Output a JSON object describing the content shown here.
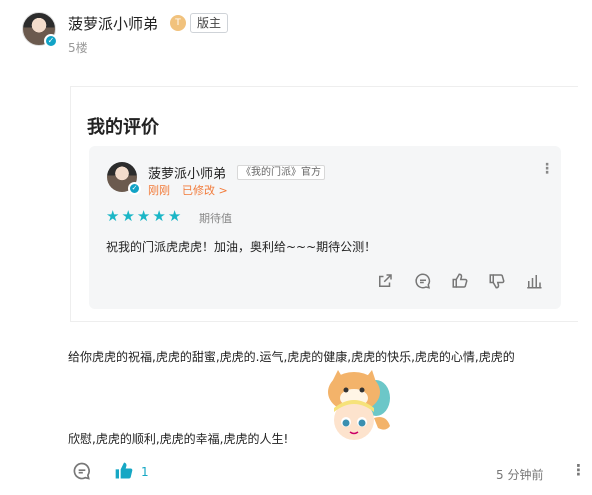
{
  "post": {
    "username": "菠萝派小师弟",
    "level_glyph": "T",
    "role_tag": "版主",
    "floor": "5楼"
  },
  "review": {
    "title": "我的评价",
    "name": "菠萝派小师弟",
    "tag": "《我的门派》官方",
    "time": "刚刚",
    "edited": "已修改 >",
    "more": "⋮",
    "stars": 5,
    "stars_label": "期待值",
    "text": "祝我的门派虎虎虎！加油，奥利给~~~期待公测！",
    "actions": [
      "share-icon",
      "comment-icon",
      "like-icon",
      "dislike-icon",
      "chart-icon"
    ]
  },
  "comment": {
    "line1": "给你虎虎的祝福,虎虎的甜蜜,虎虎的.运气,虎虎的健康,虎虎的快乐,虎虎的心情,虎虎的",
    "line2": "欣慰,虎虎的顺利,虎虎的幸福,虎虎的人生!",
    "like_count": "1",
    "time_ago": "5 分钟前",
    "more": "⋮"
  },
  "colors": {
    "accent": "#16a7c4",
    "orange": "#f27b3a",
    "star": "#1ab6c6"
  }
}
